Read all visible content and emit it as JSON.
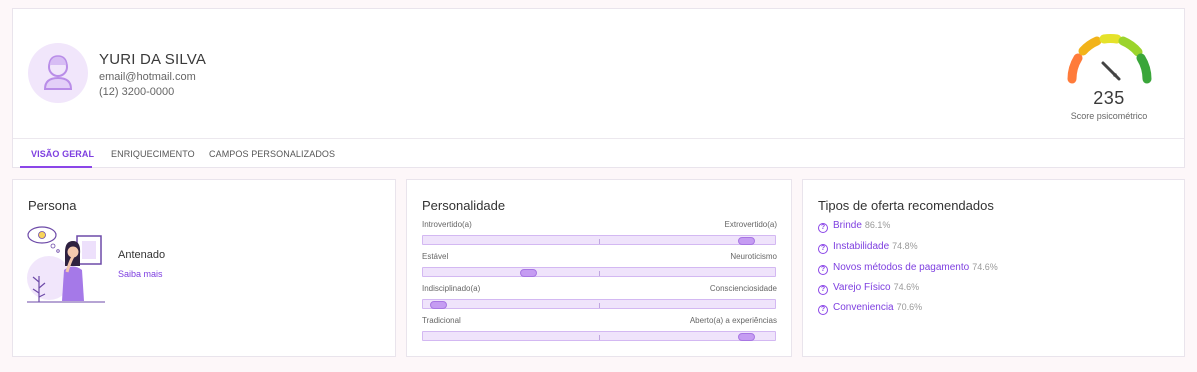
{
  "profile": {
    "name": "YURI DA SILVA",
    "email": "email@hotmail.com",
    "phone": "(12) 3200-0000",
    "avatar_icon": "user-avatar-icon"
  },
  "score": {
    "value": "235",
    "label": "Score psicométrico",
    "gauge_colors": [
      "#ff7b3a",
      "#f2b31a",
      "#e5e22a",
      "#9bd42c",
      "#3aa63a"
    ]
  },
  "tabs": [
    {
      "label": "VISÃO GERAL",
      "active": true
    },
    {
      "label": "ENRIQUECIMENTO",
      "active": false
    },
    {
      "label": "CAMPOS PERSONALIZADOS",
      "active": false
    }
  ],
  "persona": {
    "title": "Persona",
    "name": "Antenado",
    "link": "Saiba mais"
  },
  "personality": {
    "title": "Personalidade",
    "traits": [
      {
        "left": "Introvertido(a)",
        "right": "Extrovertido(a)",
        "value": 0.94
      },
      {
        "left": "Estável",
        "right": "Neuroticismo",
        "value": 0.29
      },
      {
        "left": "Indisciplinado(a)",
        "right": "Conscienciosidade",
        "value": 0.02
      },
      {
        "left": "Tradicional",
        "right": "Aberto(a) a experiências",
        "value": 0.94
      }
    ]
  },
  "offers": {
    "title": "Tipos de oferta recomendados",
    "icon": "help-circle-icon",
    "items": [
      {
        "name": "Brinde",
        "pct": "86.1%"
      },
      {
        "name": "Instabilidade",
        "pct": "74.8%"
      },
      {
        "name": "Novos métodos de pagamento",
        "pct": "74.6%"
      },
      {
        "name": "Varejo Físico",
        "pct": "74.6%"
      },
      {
        "name": "Conveniencia",
        "pct": "70.6%"
      }
    ]
  },
  "colors": {
    "accent": "#7e3fe0",
    "track": "#efe3fb",
    "knob": "#c59cf2"
  }
}
